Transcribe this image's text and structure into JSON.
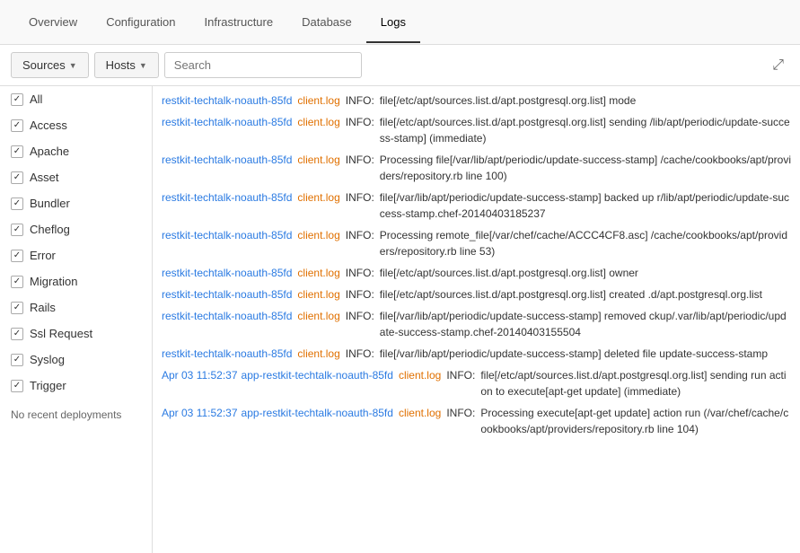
{
  "nav": {
    "tabs": [
      {
        "label": "Overview",
        "active": false
      },
      {
        "label": "Configuration",
        "active": false
      },
      {
        "label": "Infrastructure",
        "active": false
      },
      {
        "label": "Database",
        "active": false
      },
      {
        "label": "Logs",
        "active": true
      }
    ]
  },
  "toolbar": {
    "sources_label": "Sources",
    "hosts_label": "Hosts",
    "search_placeholder": "Search",
    "expand_icon": "⤢"
  },
  "dropdown": {
    "items": [
      {
        "label": "All",
        "checked": true
      },
      {
        "label": "Access",
        "checked": true
      },
      {
        "label": "Apache",
        "checked": true
      },
      {
        "label": "Asset",
        "checked": true
      },
      {
        "label": "Bundler",
        "checked": true
      },
      {
        "label": "Cheflog",
        "checked": true
      },
      {
        "label": "Error",
        "checked": true
      },
      {
        "label": "Migration",
        "checked": true
      },
      {
        "label": "Rails",
        "checked": true
      },
      {
        "label": "Ssl Request",
        "checked": true
      },
      {
        "label": "Syslog",
        "checked": true
      },
      {
        "label": "Trigger",
        "checked": true
      }
    ],
    "no_recent": "No recent deployments"
  },
  "logs": [
    {
      "timestamp": "",
      "host": "restkit-techtalk-noauth-85fd",
      "source": "client.log",
      "level": "INFO:",
      "message": "file[/etc/apt/sources.list.d/apt.postgresql.org.list] mode"
    },
    {
      "timestamp": "",
      "host": "restkit-techtalk-noauth-85fd",
      "source": "client.log",
      "level": "INFO:",
      "message": "file[/etc/apt/sources.list.d/apt.postgresql.org.list] sending /lib/apt/periodic/update-success-stamp] (immediate)"
    },
    {
      "timestamp": "",
      "host": "restkit-techtalk-noauth-85fd",
      "source": "client.log",
      "level": "INFO:",
      "message": "Processing file[/var/lib/apt/periodic/update-success-stamp] /cache/cookbooks/apt/providers/repository.rb line 100)"
    },
    {
      "timestamp": "",
      "host": "restkit-techtalk-noauth-85fd",
      "source": "client.log",
      "level": "INFO:",
      "message": "file[/var/lib/apt/periodic/update-success-stamp] backed up r/lib/apt/periodic/update-success-stamp.chef-20140403185237"
    },
    {
      "timestamp": "",
      "host": "restkit-techtalk-noauth-85fd",
      "source": "client.log",
      "level": "INFO:",
      "message": "Processing remote_file[/var/chef/cache/ACCC4CF8.asc] /cache/cookbooks/apt/providers/repository.rb line 53)"
    },
    {
      "timestamp": "",
      "host": "restkit-techtalk-noauth-85fd",
      "source": "client.log",
      "level": "INFO:",
      "message": "file[/etc/apt/sources.list.d/apt.postgresql.org.list] owner"
    },
    {
      "timestamp": "",
      "host": "restkit-techtalk-noauth-85fd",
      "source": "client.log",
      "level": "INFO:",
      "message": "file[/etc/apt/sources.list.d/apt.postgresql.org.list] created .d/apt.postgresql.org.list"
    },
    {
      "timestamp": "",
      "host": "restkit-techtalk-noauth-85fd",
      "source": "client.log",
      "level": "INFO:",
      "message": "file[/var/lib/apt/periodic/update-success-stamp] removed ckup/.var/lib/apt/periodic/update-success-stamp.chef-20140403155504"
    },
    {
      "timestamp": "",
      "host": "restkit-techtalk-noauth-85fd",
      "source": "client.log",
      "level": "INFO:",
      "message": "file[/var/lib/apt/periodic/update-success-stamp] deleted file update-success-stamp"
    },
    {
      "timestamp": "Apr 03 11:52:37",
      "host": "app-restkit-techtalk-noauth-85fd",
      "source": "client.log",
      "level": "INFO:",
      "message": "file[/etc/apt/sources.list.d/apt.postgresql.org.list] sending run action to execute[apt-get update] (immediate)"
    },
    {
      "timestamp": "Apr 03 11:52:37",
      "host": "app-restkit-techtalk-noauth-85fd",
      "source": "client.log",
      "level": "INFO:",
      "message": "Processing execute[apt-get update] action run (/var/chef/cache/cookbooks/apt/providers/repository.rb line 104)"
    }
  ]
}
